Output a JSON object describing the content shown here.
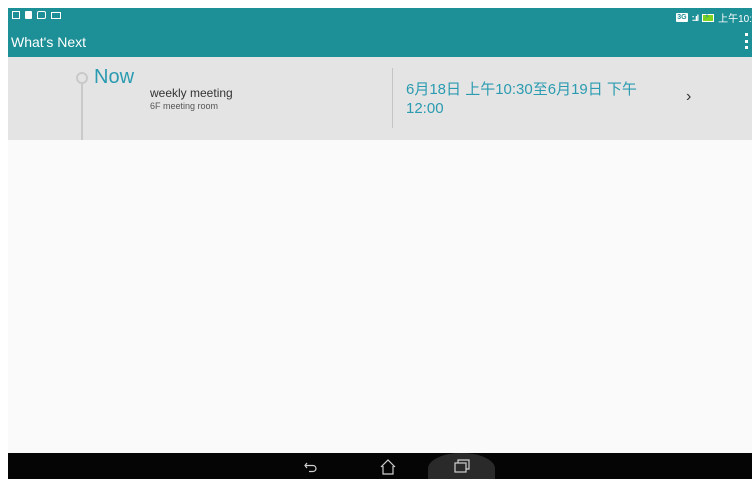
{
  "status_bar": {
    "network_badge": "3G",
    "clock": "上午10:"
  },
  "app": {
    "title": "What's Next"
  },
  "event": {
    "now_label": "Now",
    "title": "weekly meeting",
    "location": "6F meeting room",
    "time_range": "6月18日 上午10:30至6月19日 下午12:00"
  },
  "icons": {
    "status_left": [
      "image-icon",
      "document-icon",
      "sync-icon",
      "screen-icon"
    ],
    "status_right": [
      "network-icon",
      "signal-icon",
      "battery-charging-icon"
    ],
    "actions": [
      "overflow-menu-icon",
      "chevron-right-icon"
    ],
    "navigation": [
      "back-icon",
      "home-icon",
      "recent-apps-icon"
    ]
  },
  "colors": {
    "accent": "#1d8f96",
    "link_text": "#2a9bb0",
    "card_background": "#e4e4e4",
    "nav_background": "#050505"
  }
}
